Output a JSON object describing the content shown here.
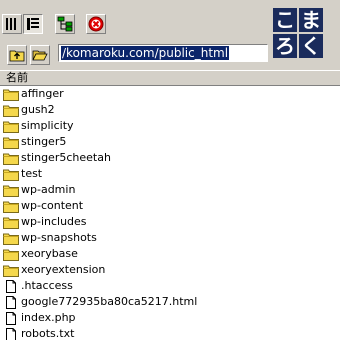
{
  "toolbar": {
    "view_list_icon": "list-view-icon",
    "view_detail_icon": "detail-view-icon",
    "tree_icon": "tree-icon",
    "stop_icon": "stop-icon"
  },
  "logo": {
    "chars": [
      "こ",
      "ま",
      "ろ",
      "く"
    ],
    "color": "#1a2b5c"
  },
  "path": {
    "value": "/komaroku.com/public_html"
  },
  "list": {
    "column_header": "名前",
    "items": [
      {
        "name": "affinger",
        "type": "folder"
      },
      {
        "name": "gush2",
        "type": "folder"
      },
      {
        "name": "simplicity",
        "type": "folder"
      },
      {
        "name": "stinger5",
        "type": "folder"
      },
      {
        "name": "stinger5cheetah",
        "type": "folder"
      },
      {
        "name": "test",
        "type": "folder"
      },
      {
        "name": "wp-admin",
        "type": "folder"
      },
      {
        "name": "wp-content",
        "type": "folder"
      },
      {
        "name": "wp-includes",
        "type": "folder"
      },
      {
        "name": "wp-snapshots",
        "type": "folder"
      },
      {
        "name": "xeorybase",
        "type": "folder"
      },
      {
        "name": "xeoryextension",
        "type": "folder"
      },
      {
        "name": ".htaccess",
        "type": "file"
      },
      {
        "name": "google772935ba80ca5217.html",
        "type": "file"
      },
      {
        "name": "index.php",
        "type": "file"
      },
      {
        "name": "robots.txt",
        "type": "file"
      }
    ]
  }
}
